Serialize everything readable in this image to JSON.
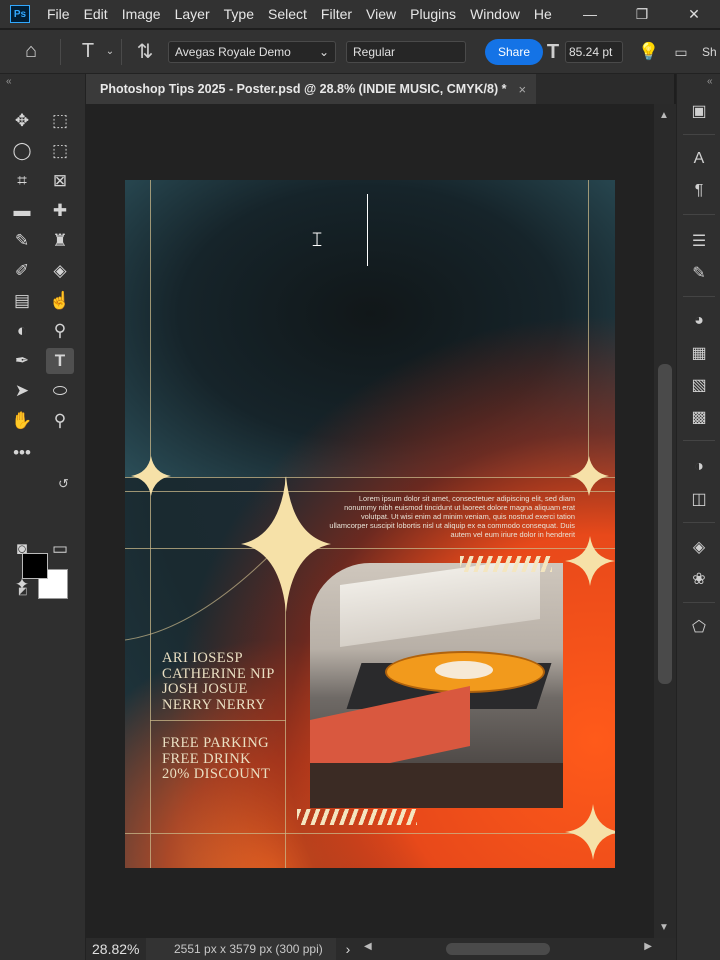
{
  "menubar": {
    "logo": "Ps",
    "items": [
      "File",
      "Edit",
      "Image",
      "Layer",
      "Type",
      "Select",
      "Filter",
      "View",
      "Plugins",
      "Window",
      "He"
    ]
  },
  "options": {
    "font_family": "Avegas Royale Demo",
    "font_style": "Regular",
    "share_label": "Share",
    "font_size": "85.24 pt",
    "trailing": "Sh"
  },
  "document_tab": {
    "title": "Photoshop Tips 2025 - Poster.psd @ 28.8% (INDIE MUSIC, CMYK/8) *",
    "close": "×"
  },
  "poster": {
    "lorem": "Lorem ipsum dolor sit amet, consectetuer adipiscing elit, sed diam nonummy nibh euismod tincidunt ut laoreet dolore magna aliquam erat volutpat. Ut wisi enim ad minim veniam, quis nostrud exerci tation ullamcorper suscipit lobortis nisl ut aliquip ex ea commodo consequat. Duis autem vel eum iriure dolor in hendrerit",
    "names": [
      "ARI IOSESP",
      "CATHERINE NIP",
      "JOSH JOSUE",
      "NERRY NERRY"
    ],
    "perks": [
      "FREE PARKING",
      "FREE DRINK",
      "20% DISCOUNT"
    ]
  },
  "status": {
    "zoom": "28.82%",
    "doc_info": "2551 px x 3579 px (300 ppi)",
    "arrow": "›"
  },
  "colors": {
    "accent": "#1473e6",
    "poster_cream": "#f6e1a8",
    "poster_orange": "#e8491a",
    "foreground": "#000000",
    "background": "#ffffff"
  }
}
